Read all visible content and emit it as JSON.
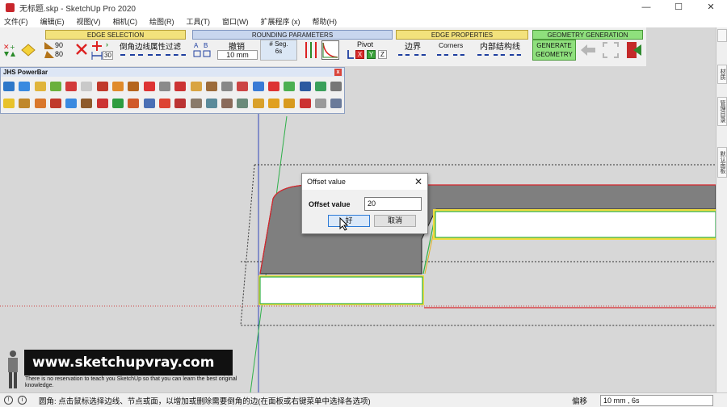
{
  "window": {
    "title": "无标题.skp - SketchUp Pro 2020",
    "controls": [
      "—",
      "☐",
      "✕"
    ]
  },
  "menu": [
    "文件(F)",
    "编辑(E)",
    "视图(V)",
    "相机(C)",
    "绘图(R)",
    "工具(T)",
    "窗口(W)",
    "扩展程序 (x)",
    "帮助(H)"
  ],
  "toolbar": {
    "sections": {
      "edge_selection": "EDGE SELECTION",
      "rounding_parameters": "ROUNDING PARAMETERS",
      "edge_properties": "EDGE PROPERTIES",
      "geometry_generation": "GEOMETRY GENERATION"
    },
    "angle_top": "90",
    "angle_bottom": "80",
    "angle_value": "30",
    "chamfer_label": "倒角边线属性过滤",
    "undo_label": "撤销",
    "offset_value": "10 mm",
    "seg_label": "# Seg.",
    "seg_value": "6s",
    "pivot_label": "Pivot",
    "pivot_axes": [
      "X",
      "Y",
      "Z"
    ],
    "border_label": "边界",
    "corners_label": "Corners",
    "inner_label": "内部结构线",
    "generate_label": "GENERATE GEOMETRY"
  },
  "powerbar": {
    "title": "JHS PowerBar",
    "close": "x"
  },
  "right_tray": {
    "tabs": [
      "",
      "材质",
      "管理目录",
      "默认面板"
    ]
  },
  "dialog": {
    "title": "Offset value",
    "close": "✕",
    "field_label": "Offset value",
    "field_value": "20",
    "ok_label": "好",
    "cancel_label": "取消"
  },
  "watermark": {
    "url": "www.sketchupvray.com",
    "note": "There is no reservation to teach you SketchUp so that you can learn the best original knowledge."
  },
  "status": {
    "message": "圆角: 点击鼠标选择边线、节点或面，以增加或删除需要倒角的边(在面板或右键菜单中选择各选项)",
    "measure_label": "偏移",
    "measure_value": "10 mm , 6s"
  }
}
